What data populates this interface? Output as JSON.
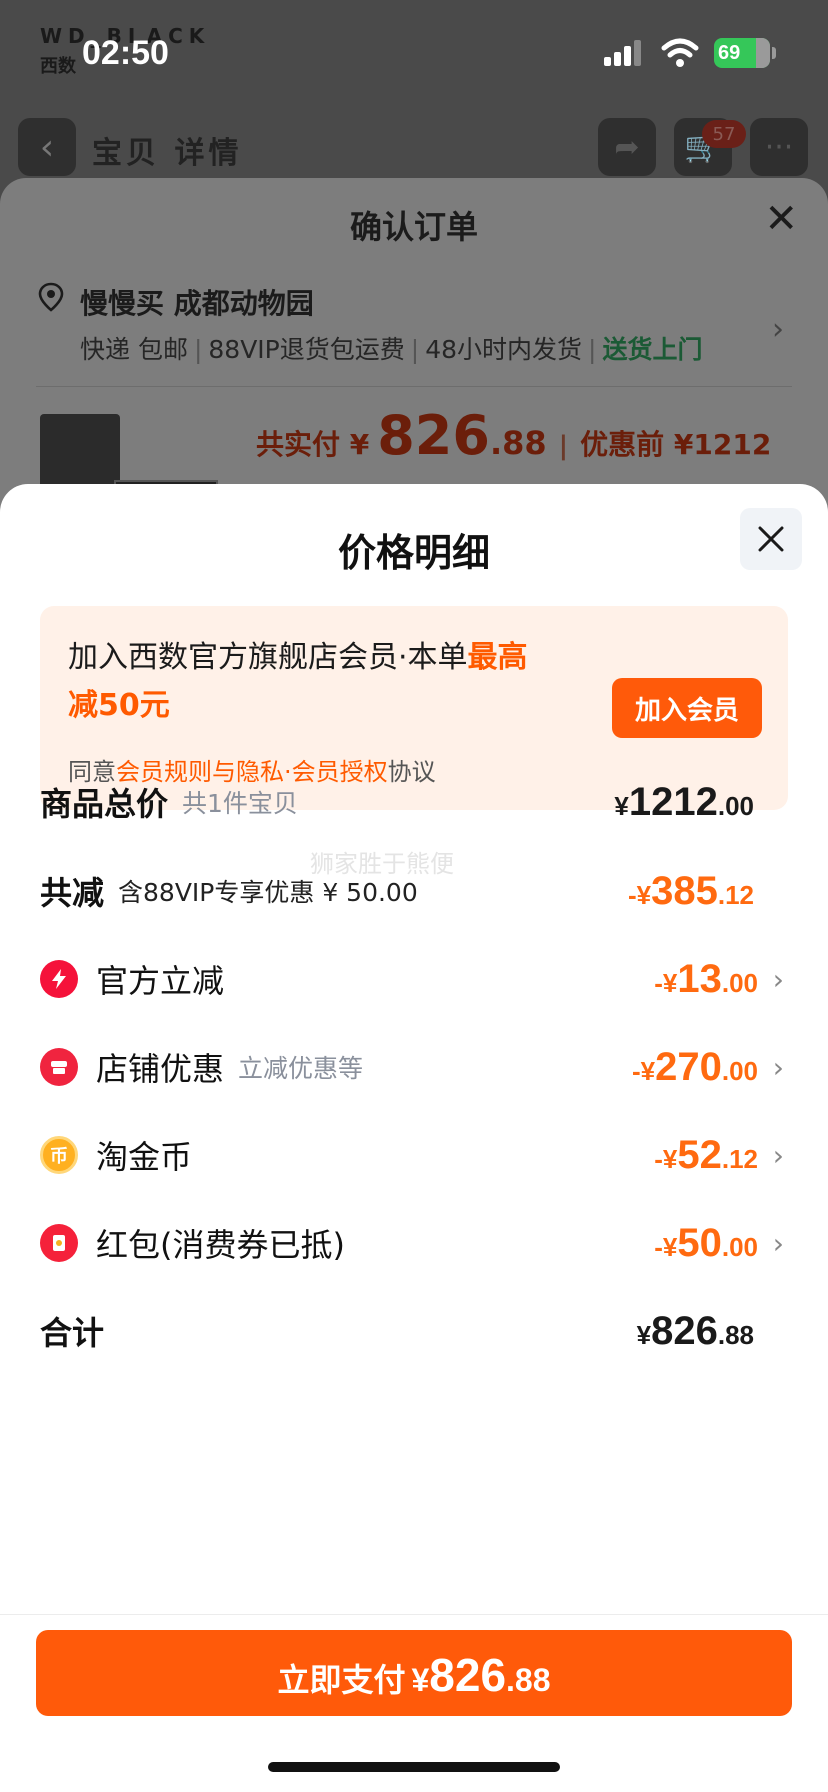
{
  "status_bar": {
    "time": "02:50",
    "battery": "69"
  },
  "background_page": {
    "brand": "WD_BLACK",
    "brand_sub": "西数",
    "tabs": "宝贝  详情",
    "cart_badge": "57"
  },
  "confirm_order": {
    "title": "确认订单",
    "address_name": "慢慢买 成都动物园",
    "shipping": {
      "express": "快递 包邮",
      "vip_return": "88VIP退货包运费",
      "ship_time": "48小时内发货",
      "delivery": "送货上门"
    },
    "pay_label": "共实付 ¥",
    "pay_int": "826",
    "pay_dec": ".88",
    "before_label": "优惠前 ¥1212"
  },
  "price_detail": {
    "title": "价格明细",
    "member": {
      "text_prefix": "加入西数官方旗舰店会员·本单",
      "text_highlight": "最高减50元",
      "agree_prefix": "同意",
      "agree_link": "会员规则与隐私·会员授权",
      "agree_suffix": "协议",
      "join_button": "加入会员"
    },
    "watermark": "狮家胜于熊便",
    "rows": {
      "total_goods": {
        "label": "商品总价",
        "sub": "共1件宝贝",
        "prefix": "¥",
        "int": "1212",
        "dec": ".00"
      },
      "total_discount": {
        "label": "共减",
        "sub": "含88VIP专享优惠 ¥ 50.00",
        "prefix": "-¥",
        "int": "385",
        "dec": ".12"
      },
      "official": {
        "label": "官方立减",
        "prefix": "-¥",
        "int": "13",
        "dec": ".00"
      },
      "store": {
        "label": "店铺优惠",
        "sub": "立减优惠等",
        "prefix": "-¥",
        "int": "270",
        "dec": ".00"
      },
      "coins": {
        "label": "淘金币",
        "icon_text": "币",
        "prefix": "-¥",
        "int": "52",
        "dec": ".12"
      },
      "red_packet": {
        "label": "红包(消费券已抵)",
        "prefix": "-¥",
        "int": "50",
        "dec": ".00"
      },
      "sum": {
        "label": "合计",
        "prefix": "¥",
        "int": "826",
        "dec": ".88"
      }
    },
    "pay_button": {
      "label": "立即支付",
      "yen": "¥",
      "int": "826",
      "dec": ".88"
    }
  },
  "colors": {
    "accent": "#ff5a0a",
    "discount": "#ff6a10",
    "member_bg": "#fff1e8"
  }
}
